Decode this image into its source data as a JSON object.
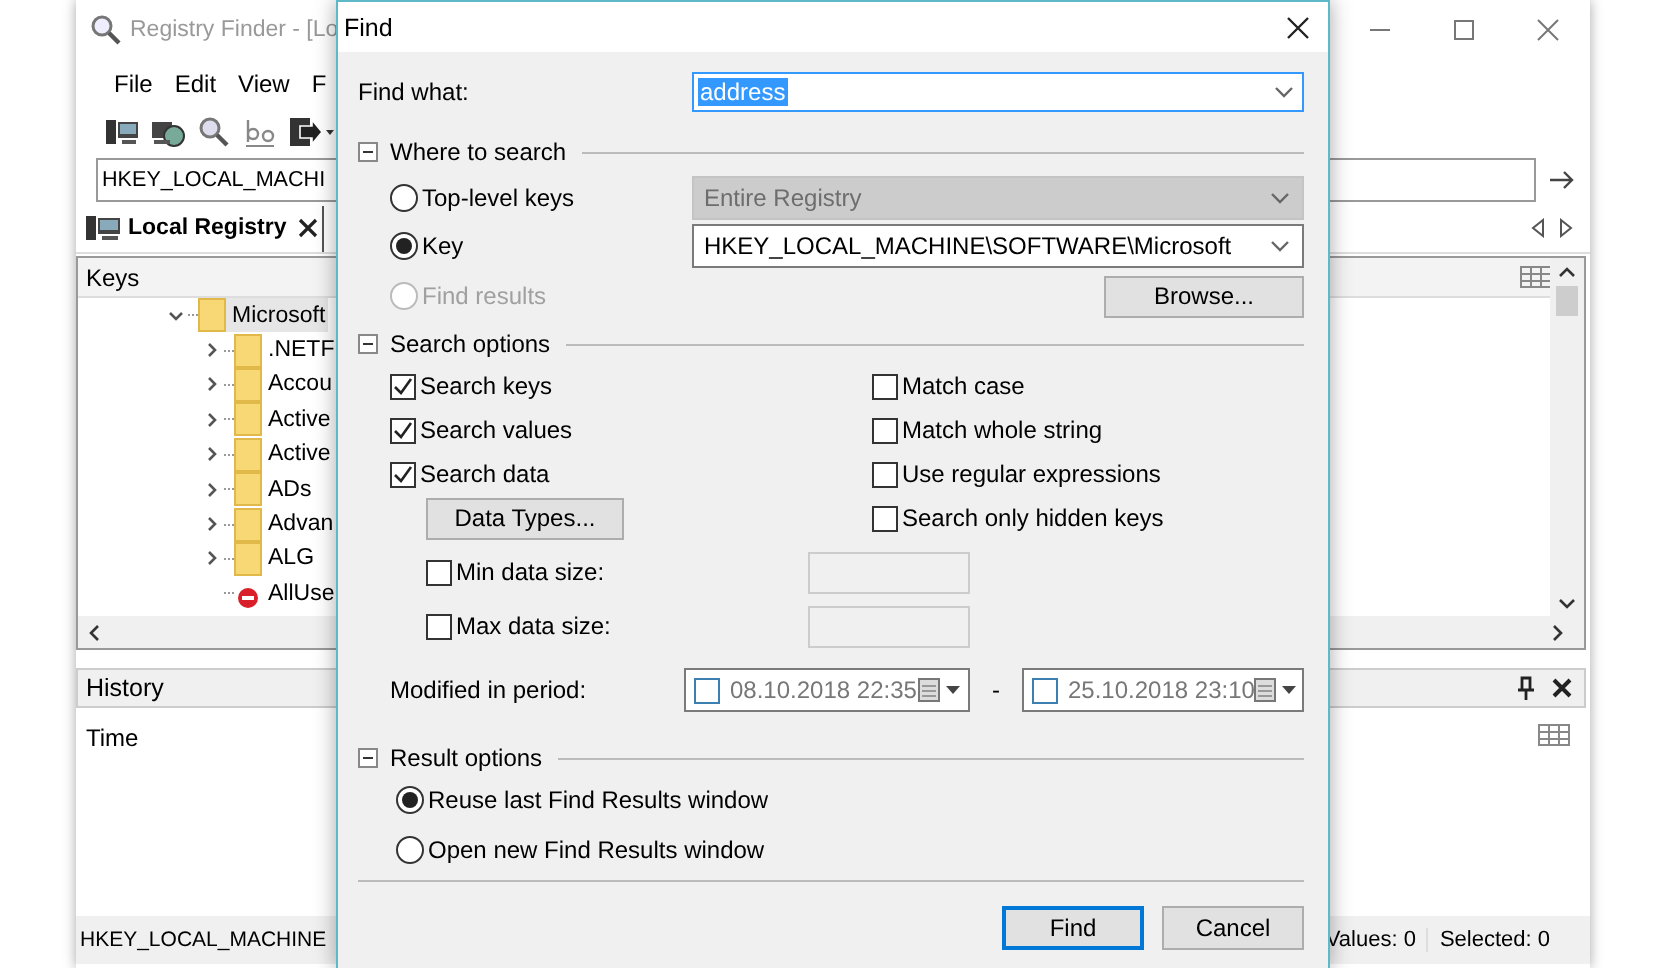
{
  "main_window": {
    "title": "Registry Finder - [Lo",
    "menu": [
      "File",
      "Edit",
      "View",
      "F"
    ],
    "address": "HKEY_LOCAL_MACHI",
    "tabs": [
      {
        "label": "Local Registry",
        "selected": true
      }
    ],
    "keys_panel": {
      "title": "Keys",
      "tree": [
        {
          "label": "Microsoft",
          "kind": "folder",
          "expanded": true,
          "selected": true,
          "children": [
            {
              "label": ".NETF",
              "kind": "folder",
              "expanded": false,
              "selected": false
            },
            {
              "label": "Accou",
              "kind": "folder",
              "expanded": false,
              "selected": false
            },
            {
              "label": "Active",
              "kind": "folder",
              "expanded": false,
              "selected": false
            },
            {
              "label": "Active",
              "kind": "folder",
              "expanded": false,
              "selected": false
            },
            {
              "label": "ADs",
              "kind": "folder",
              "expanded": false,
              "selected": false
            },
            {
              "label": "Advan",
              "kind": "folder",
              "expanded": false,
              "selected": false
            },
            {
              "label": "ALG",
              "kind": "folder",
              "expanded": false,
              "selected": false
            },
            {
              "label": "AllUse",
              "kind": "denied",
              "selected": false
            }
          ]
        }
      ]
    },
    "history_panel": {
      "title": "History",
      "columns": [
        "Time"
      ]
    },
    "status_bar": {
      "path": "HKEY_LOCAL_MACHINE",
      "values": "Values: 0",
      "selected": "Selected: 0"
    }
  },
  "dialog": {
    "title": "Find",
    "find_what": {
      "label": "Find what:",
      "value": "address"
    },
    "where": {
      "title": "Where to search",
      "expanded": true,
      "options": [
        {
          "label": "Top-level keys",
          "selected": false,
          "disabled": false
        },
        {
          "label": "Key",
          "selected": true,
          "disabled": false
        },
        {
          "label": "Find results",
          "selected": false,
          "disabled": true
        }
      ],
      "scope": {
        "value": "Entire Registry",
        "disabled": true
      },
      "key": {
        "value": "HKEY_LOCAL_MACHINE\\SOFTWARE\\Microsoft",
        "disabled": false
      },
      "browse": "Browse..."
    },
    "search_options": {
      "title": "Search options",
      "expanded": true,
      "left": [
        {
          "label": "Search keys",
          "checked": true
        },
        {
          "label": "Search values",
          "checked": true
        },
        {
          "label": "Search data",
          "checked": true
        }
      ],
      "data_types": "Data Types...",
      "right": [
        {
          "label": "Match case",
          "checked": false
        },
        {
          "label": "Match whole string",
          "checked": false
        },
        {
          "label": "Use regular expressions",
          "checked": false
        },
        {
          "label": "Search only hidden keys",
          "checked": false
        }
      ],
      "sizes": [
        {
          "label": "Min data size:",
          "checked": false
        },
        {
          "label": "Max data size:",
          "checked": false
        }
      ],
      "modified": {
        "label": "Modified in period:",
        "from": {
          "checked": false,
          "value": "08.10.2018 22:35"
        },
        "separator": "-",
        "to": {
          "checked": false,
          "value": "25.10.2018 23:10"
        }
      }
    },
    "result_options": {
      "title": "Result options",
      "expanded": true,
      "options": [
        {
          "label": "Reuse last Find Results window",
          "selected": true
        },
        {
          "label": "Open new Find Results window",
          "selected": false
        }
      ]
    },
    "buttons": [
      {
        "label": "Find",
        "default": true
      },
      {
        "label": "Cancel",
        "default": false
      }
    ]
  }
}
